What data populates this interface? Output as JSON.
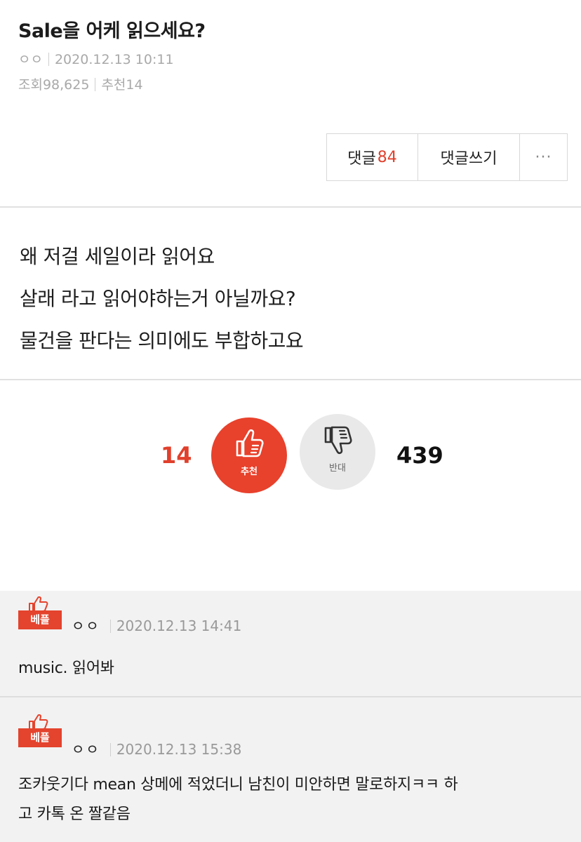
{
  "post": {
    "title": "Sale을 어케 읽으세요?",
    "author": "ㅇㅇ",
    "datetime": "2020.12.13 10:11",
    "views_label": "조회98,625",
    "recommend_label": "추천14"
  },
  "actions": {
    "comments_label": "댓글",
    "comments_count": "84",
    "write_comment_label": "댓글쓰기",
    "more_label": "···"
  },
  "body": {
    "lines": [
      "왜 저걸 세일이라 읽어요",
      "살래 라고 읽어야하는거 아닐까요?",
      "물건을 판다는 의미에도 부합하고요"
    ]
  },
  "votes": {
    "up_count": "14",
    "up_label": "추천",
    "down_label": "반대",
    "down_count": "439"
  },
  "comments": [
    {
      "badge": "베플",
      "author": "ㅇㅇ",
      "datetime": "2020.12.13 14:41",
      "lines": [
        "music. 읽어봐"
      ]
    },
    {
      "badge": "베플",
      "author": "ㅇㅇ",
      "datetime": "2020.12.13 15:38",
      "lines": [
        "조카웃기다 mean 상메에 적었더니 남친이 미안하면 말로하지ㅋㅋ 하",
        "고 카톡 온 짤같음"
      ]
    }
  ],
  "colors": {
    "accent": "#e8412c",
    "meta_text": "#a9a9a9",
    "comment_bg": "#f2f2f2"
  },
  "icons": {
    "thumbs_up": "thumbs-up-icon",
    "thumbs_down": "thumbs-down-icon",
    "best_badge": "thumbs-up-outline-icon"
  }
}
